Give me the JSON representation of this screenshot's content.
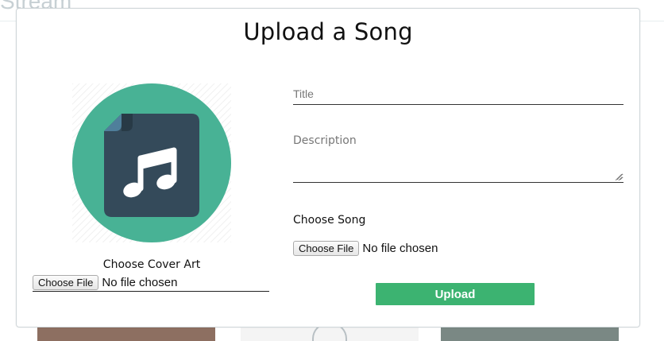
{
  "background": {
    "brand_text": "Stream"
  },
  "modal": {
    "title": "Upload a Song",
    "cover": {
      "icon": "music-file-icon",
      "label": "Choose Cover Art",
      "file_button_label": "Choose File",
      "file_status": "No file chosen"
    },
    "form": {
      "title_placeholder": "Title",
      "title_value": "",
      "description_placeholder": "Description",
      "description_value": "",
      "song_label": "Choose Song",
      "song_file_button_label": "Choose File",
      "song_file_status": "No file chosen",
      "submit_label": "Upload"
    }
  },
  "colors": {
    "accent": "#3cb371",
    "cover_circle": "#48b295",
    "cover_doc": "#344a5a",
    "cover_corner": "#4f7f9b"
  }
}
